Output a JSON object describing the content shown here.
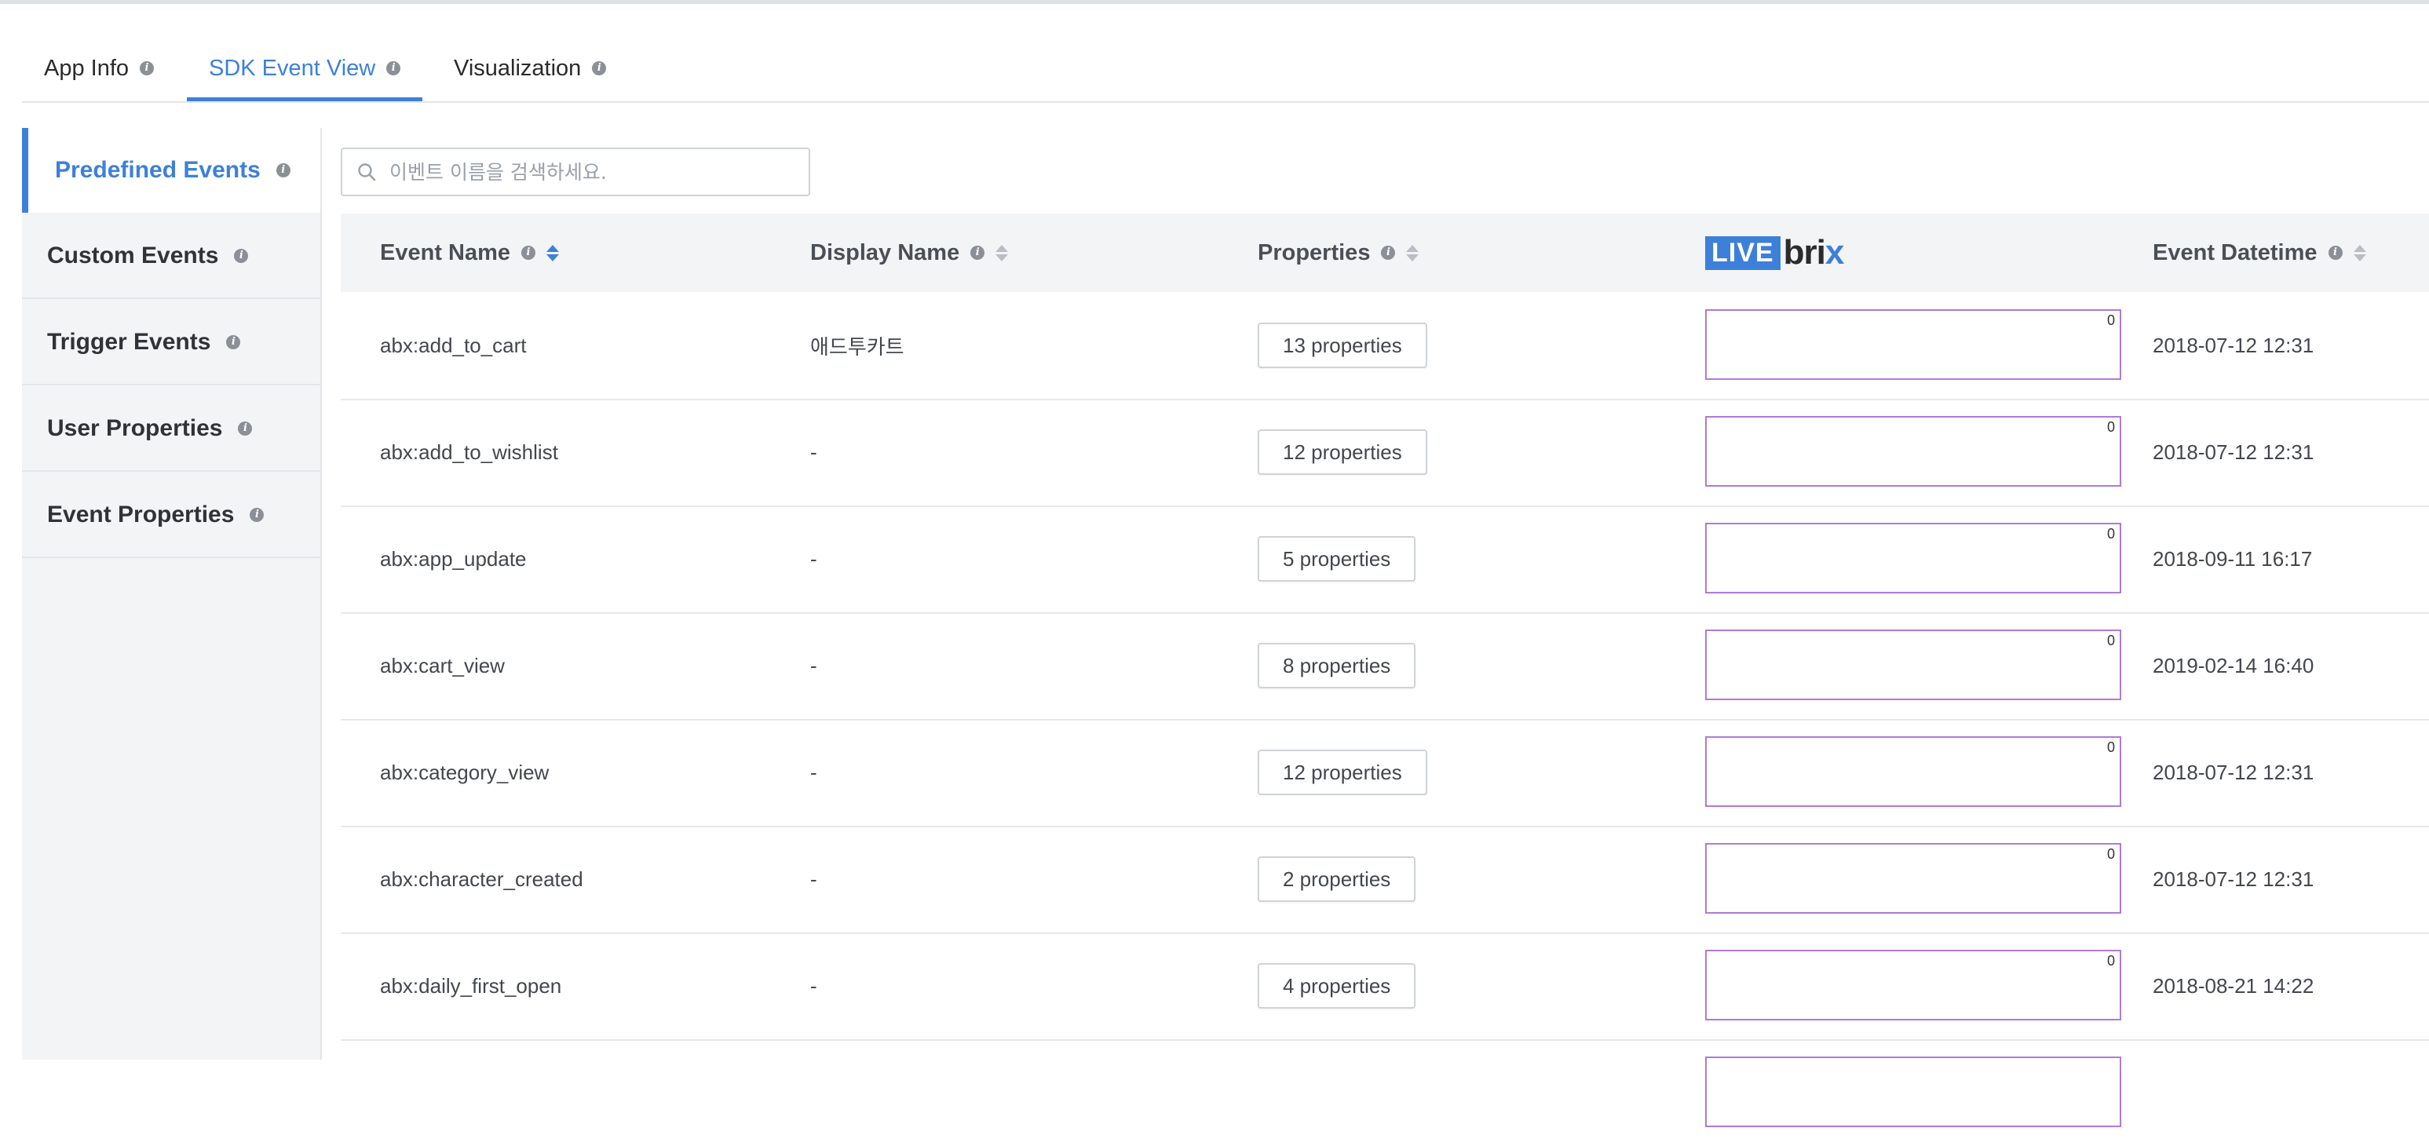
{
  "tabs": [
    {
      "label": "App Info",
      "active": false
    },
    {
      "label": "SDK Event View",
      "active": true
    },
    {
      "label": "Visualization",
      "active": false
    }
  ],
  "sidebar": {
    "items": [
      {
        "label": "Predefined Events",
        "active": true
      },
      {
        "label": "Custom Events",
        "active": false
      },
      {
        "label": "Trigger Events",
        "active": false
      },
      {
        "label": "User Properties",
        "active": false
      },
      {
        "label": "Event Properties",
        "active": false
      }
    ]
  },
  "search": {
    "placeholder": "이벤트 이름을 검색하세요.",
    "value": ""
  },
  "table": {
    "headers": {
      "event_name": "Event Name",
      "display_name": "Display Name",
      "properties": "Properties",
      "livebrix_live": "LIVE",
      "livebrix_bri": "bri",
      "livebrix_x": "x",
      "event_datetime": "Event Datetime"
    },
    "sorted_column": "event_name",
    "rows": [
      {
        "event_name": "abx:add_to_cart",
        "display_name": "애드투카트",
        "properties": "13 properties",
        "live_count": "0",
        "datetime": "2018-07-12 12:31"
      },
      {
        "event_name": "abx:add_to_wishlist",
        "display_name": "-",
        "properties": "12 properties",
        "live_count": "0",
        "datetime": "2018-07-12 12:31"
      },
      {
        "event_name": "abx:app_update",
        "display_name": "-",
        "properties": "5 properties",
        "live_count": "0",
        "datetime": "2018-09-11 16:17"
      },
      {
        "event_name": "abx:cart_view",
        "display_name": "-",
        "properties": "8 properties",
        "live_count": "0",
        "datetime": "2019-02-14 16:40"
      },
      {
        "event_name": "abx:category_view",
        "display_name": "-",
        "properties": "12 properties",
        "live_count": "0",
        "datetime": "2018-07-12 12:31"
      },
      {
        "event_name": "abx:character_created",
        "display_name": "-",
        "properties": "2 properties",
        "live_count": "0",
        "datetime": "2018-07-12 12:31"
      },
      {
        "event_name": "abx:daily_first_open",
        "display_name": "-",
        "properties": "4 properties",
        "live_count": "0",
        "datetime": "2018-08-21 14:22"
      }
    ]
  },
  "colors": {
    "accent": "#3d80d9",
    "sparkline_border": "#b07ad6"
  }
}
